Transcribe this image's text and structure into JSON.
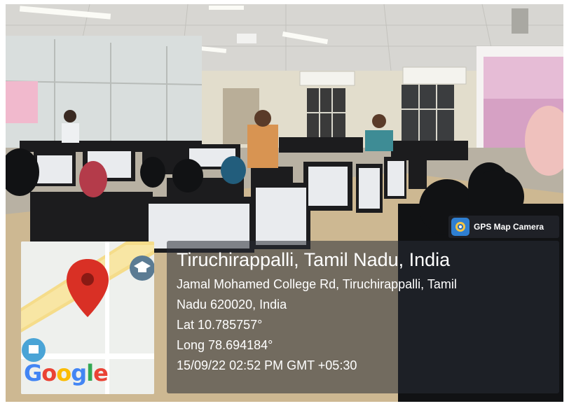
{
  "badge": {
    "label": "GPS Map Camera",
    "icon": "camera-icon"
  },
  "location": {
    "city_line": "Tiruchirappalli, Tamil Nadu, India",
    "address_line_1": "Jamal Mohamed College Rd, Tiruchirappalli, Tamil",
    "address_line_2": "Nadu 620020, India",
    "latitude": "Lat 10.785757°",
    "longitude": "Long 78.694184°",
    "timestamp": "15/09/22 02:52 PM GMT +05:30"
  },
  "map": {
    "brand": [
      "G",
      "o",
      "o",
      "g",
      "l",
      "e"
    ],
    "pin_icon": "map-pin-icon",
    "poi_icon": "graduation-cap-icon",
    "pin_color": "#d93025"
  }
}
